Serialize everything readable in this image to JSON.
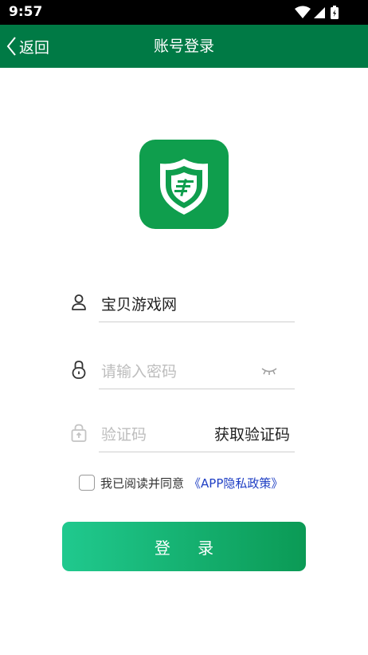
{
  "status_bar": {
    "time": "9:57",
    "icons": [
      "wifi-icon",
      "signal-icon",
      "battery-icon"
    ]
  },
  "nav": {
    "back_label": "返回",
    "title": "账号登录",
    "background": "#007a45"
  },
  "logo": {
    "icon": "app-shield-logo",
    "color": "#0f9e4d"
  },
  "form": {
    "username_value": "宝贝游戏网",
    "password_placeholder": "请输入密码",
    "code_placeholder": "验证码",
    "get_code_label": "获取验证码"
  },
  "agreement": {
    "text": "我已阅读并同意",
    "link": "《APP隐私政策》",
    "checked": false,
    "link_color": "#1f3fc4"
  },
  "login_button": {
    "label": "登 录",
    "gradient": [
      "#20c98e",
      "#0b9a55"
    ]
  }
}
